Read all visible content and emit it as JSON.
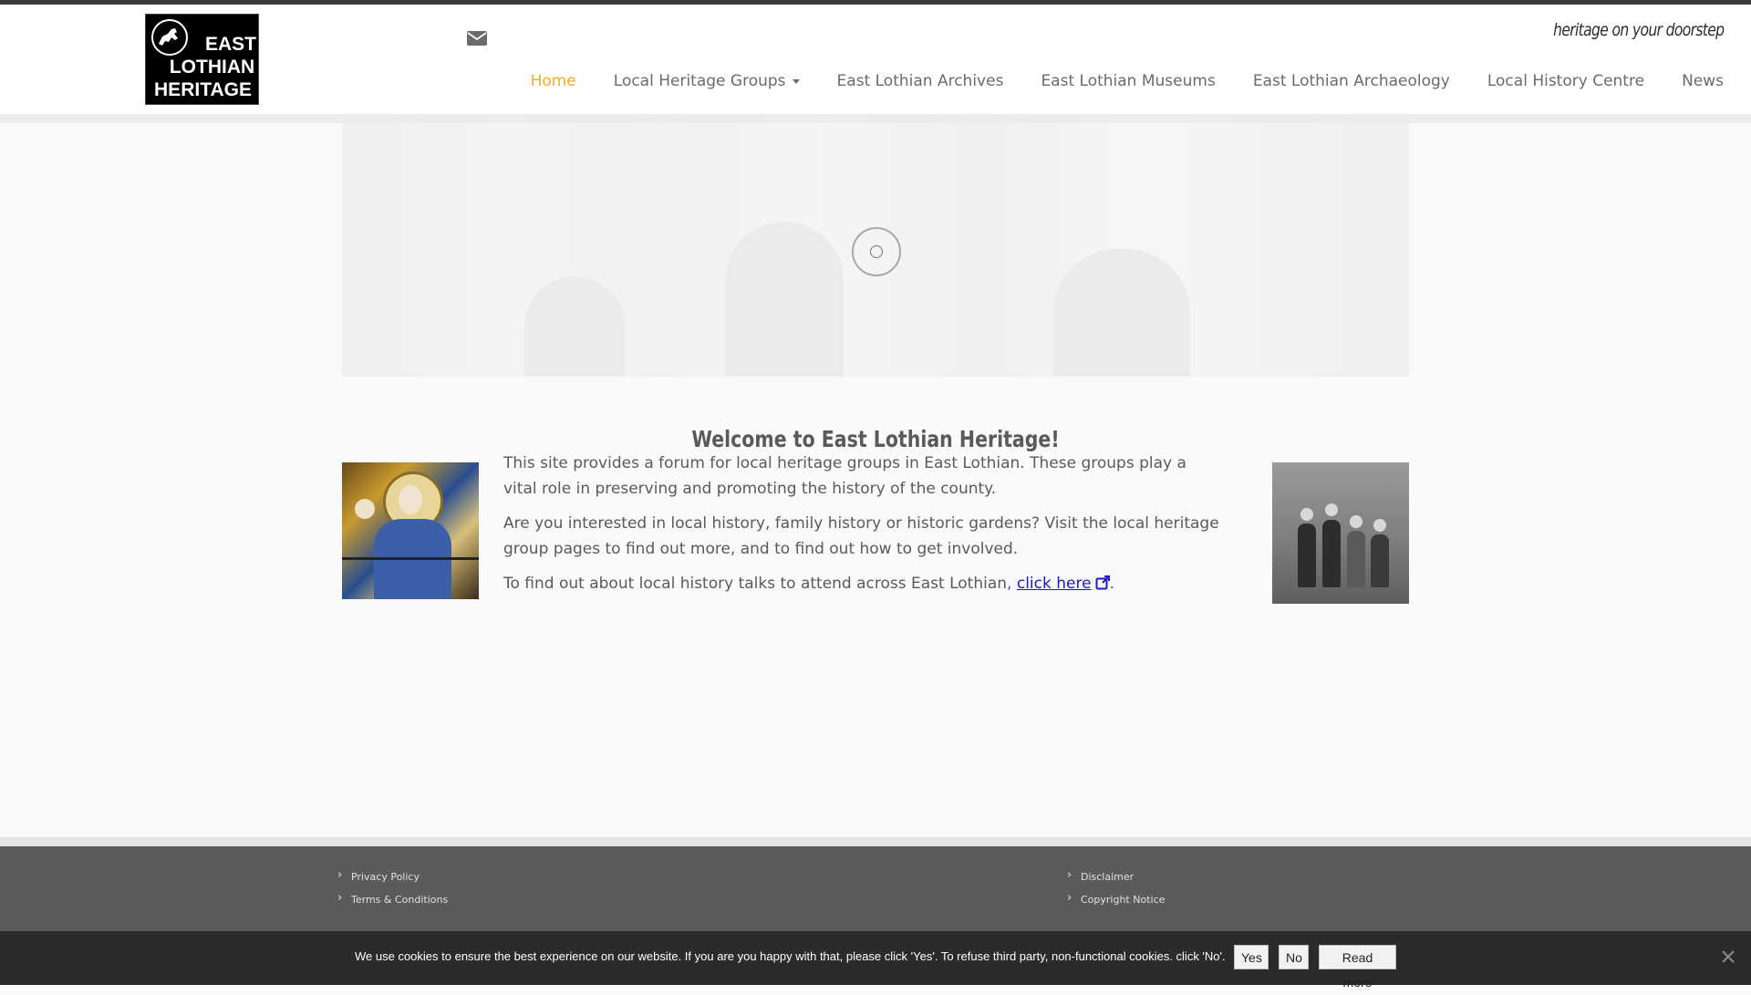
{
  "header": {
    "logo": {
      "line1": "EAST",
      "line2": "LOTHIAN",
      "line3": "HERITAGE"
    },
    "tagline": "heritage on your doorstep",
    "contact_icon": "envelope-icon"
  },
  "nav": {
    "items": [
      {
        "label": "Home",
        "active": true
      },
      {
        "label": "Local Heritage Groups",
        "has_dropdown": true
      },
      {
        "label": "East Lothian Archives"
      },
      {
        "label": "East Lothian Museums"
      },
      {
        "label": "East Lothian Archaeology"
      },
      {
        "label": "Local History Centre"
      },
      {
        "label": "News"
      }
    ]
  },
  "main": {
    "title": "Welcome to East Lothian Heritage!",
    "paragraphs": [
      "This site provides a forum for local heritage groups in East Lothian. These groups play a vital role in preserving and promoting the history of the county.",
      "Are you interested in local history, family history or historic gardens? Visit the local heritage group pages to find out more, and to find out how to get involved."
    ],
    "talks_text": "To find out about local history talks to attend across East Lothian,",
    "talks_link": "click here",
    "talks_end": "."
  },
  "footer": {
    "left_links": [
      "Privacy Policy",
      "Terms & Conditions"
    ],
    "right_links": [
      "Disclaimer",
      "Copyright Notice"
    ]
  },
  "cookie": {
    "text": "We use cookies to ensure the best experience on our website. If you are you happy with that, please click 'Yes'. To refuse third party, non-functional cookies. click 'No'.",
    "yes": "Yes",
    "no": "No",
    "read_more": "Read more"
  },
  "colors": {
    "accent": "#f0ad1e",
    "nav_text": "#6b6b6b",
    "footer_bg": "#5b5b5b",
    "cookie_bg": "#2b2b2b",
    "link": "#1a1ac8"
  }
}
